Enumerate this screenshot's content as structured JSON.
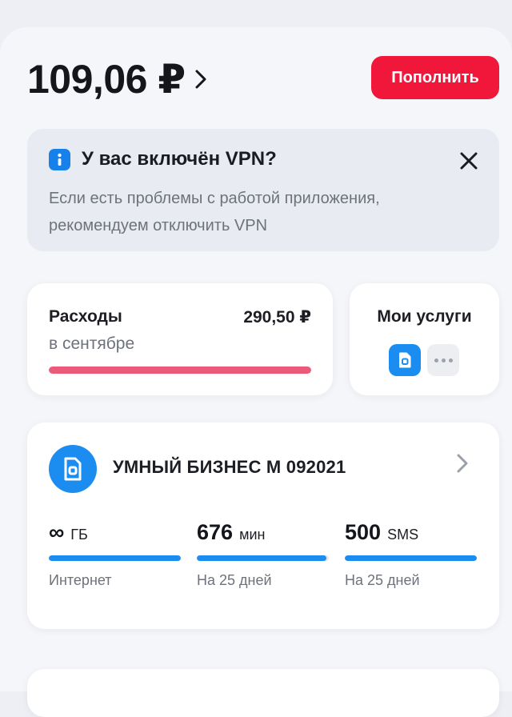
{
  "balance": {
    "amount": "109,06 ₽"
  },
  "topup": {
    "label": "Пополнить"
  },
  "vpn_notice": {
    "title": "У вас включён VPN?",
    "text": "Если есть проблемы с работой приложения, рекомендуем отключить VPN"
  },
  "expenses": {
    "title": "Расходы",
    "amount": "290,50 ₽",
    "period": "в сентябре",
    "progress_percent": 100
  },
  "services": {
    "title": "Мои услуги"
  },
  "tariff": {
    "name": "УМНЫЙ БИЗНЕС М 092021",
    "quotas": [
      {
        "value": "∞",
        "unit": "ГБ",
        "label": "Интернет",
        "progress_percent": 100
      },
      {
        "value": "676",
        "unit": "мин",
        "label": "На 25 дней",
        "progress_percent": 98
      },
      {
        "value": "500",
        "unit": "SMS",
        "label": "На 25 дней",
        "progress_percent": 100
      }
    ]
  },
  "colors": {
    "accent_red": "#f0173b",
    "accent_blue": "#1b8cf0",
    "expense_bar": "#ec5a79"
  }
}
